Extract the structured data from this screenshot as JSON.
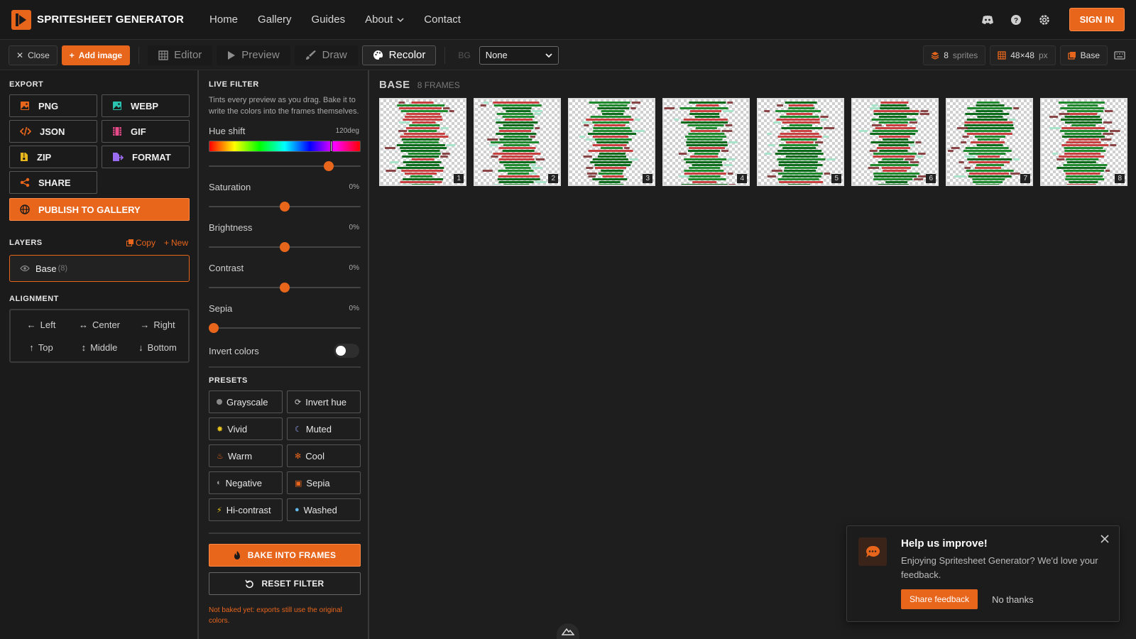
{
  "app": {
    "title": "SPRITESHEET GENERATOR",
    "brand_color": "#e8651c"
  },
  "nav": {
    "links": [
      "Home",
      "Gallery",
      "Guides",
      "About",
      "Contact"
    ],
    "signin": "SIGN IN",
    "icons": [
      "discord-icon",
      "help-icon",
      "settings-icon"
    ]
  },
  "toolbar": {
    "close": "Close",
    "add_image": "Add image",
    "modes": [
      "Editor",
      "Preview",
      "Draw",
      "Recolor"
    ],
    "active_mode": "Recolor",
    "bg_label": "BG",
    "bg_value": "None",
    "sprites_count": "8",
    "sprites_label": "sprites",
    "size": "48×48",
    "size_unit": "px",
    "layer_chip": "Base"
  },
  "export": {
    "title": "EXPORT",
    "buttons": [
      "PNG",
      "WEBP",
      "JSON",
      "GIF",
      "ZIP",
      "FORMAT",
      "SHARE"
    ],
    "publish": "PUBLISH TO GALLERY"
  },
  "layers": {
    "title": "LAYERS",
    "copy": "Copy",
    "new": "New",
    "items": [
      {
        "name": "Base",
        "count": "(8)"
      }
    ]
  },
  "alignment": {
    "title": "ALIGNMENT",
    "buttons": [
      "Left",
      "Center",
      "Right",
      "Top",
      "Middle",
      "Bottom"
    ]
  },
  "filter": {
    "title": "LIVE FILTER",
    "description": "Tints every preview as you drag. Bake it to write the colors into the frames themselves.",
    "hue": {
      "label": "Hue shift",
      "value": "120deg",
      "fraction": 0.81
    },
    "sliders": [
      {
        "label": "Saturation",
        "value": "0%",
        "fraction": 0.5
      },
      {
        "label": "Brightness",
        "value": "0%",
        "fraction": 0.5
      },
      {
        "label": "Contrast",
        "value": "0%",
        "fraction": 0.5
      },
      {
        "label": "Sepia",
        "value": "0%",
        "fraction": 0.0
      }
    ],
    "invert": {
      "label": "Invert colors",
      "on": false
    },
    "presets_title": "PRESETS",
    "presets": [
      "Grayscale",
      "Invert hue",
      "Vivid",
      "Muted",
      "Warm",
      "Cool",
      "Negative",
      "Sepia",
      "Hi-contrast",
      "Washed"
    ],
    "bake": "BAKE INTO FRAMES",
    "reset": "RESET FILTER",
    "note": "Not baked yet: exports still use the original colors."
  },
  "canvas": {
    "layer_name": "BASE",
    "frames_label": "8 FRAMES",
    "frames": [
      "1",
      "2",
      "3",
      "4",
      "5",
      "6",
      "7",
      "8"
    ]
  },
  "toast": {
    "title": "Help us improve!",
    "text": "Enjoying Spritesheet Generator? We'd love your feedback.",
    "share": "Share feedback",
    "dismiss": "No thanks"
  }
}
